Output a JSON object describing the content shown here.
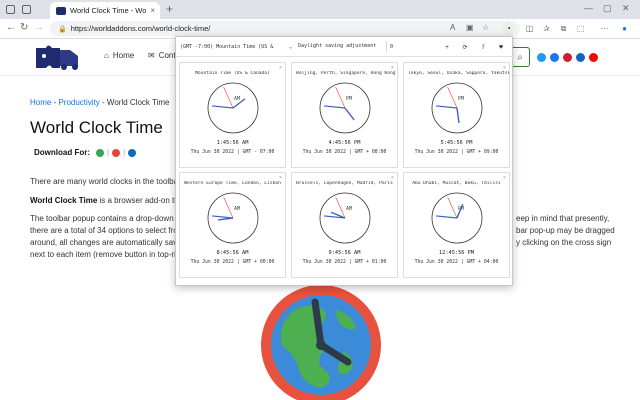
{
  "browser": {
    "tab_title": "World Clock Time - WorldAdd",
    "tab_close": "×",
    "new_tab": "+",
    "url": "https://worldaddons.com/world-clock-time/"
  },
  "site": {
    "nav": {
      "home": "Home",
      "contact": "Cont"
    },
    "breadcrumb": {
      "home": "Home",
      "sep": " - ",
      "category": "Productivity",
      "current": " - World Clock Time"
    },
    "title": "World Clock Time",
    "download_for": "Download For:",
    "para1": "There are many world clocks in the toolbar popu",
    "para2_bold": "World Clock Time",
    "para2_rest": " is a browser add-on that all",
    "para3_lines": [
      "The toolbar popup contains a drop-down menu",
      "there are a total of 34 options to select from. Yo",
      "around, all changes are automatically saved to",
      "next to each item (remove button in top-right c"
    ],
    "para3_right": [
      "eep in mind that presently,",
      "bar pop-up may be dragged",
      "y clicking on the cross sign"
    ]
  },
  "popup": {
    "timezone_selected": "(GMT -7:00) Mountain Time (US &",
    "dst_label": "Daylight saving adjustment",
    "dst_value": "0",
    "buttons": {
      "add": "+",
      "refresh": "⟳",
      "help": "?",
      "favorite": "♥"
    },
    "close_mark": "×",
    "clocks": [
      {
        "name": "Mountain Time (US & Canada)",
        "ampm": "AM",
        "time": "1:45:56 AM",
        "date": "Thu Jun 30 2022 | GMT - 07:00",
        "h": 1,
        "m": 45,
        "s": 56
      },
      {
        "name": "Beijing, Perth, Singapore, Hong Kong",
        "ampm": "PM",
        "time": "4:45:56 PM",
        "date": "Thu Jun 30 2022 | GMT + 08:00",
        "h": 4,
        "m": 45,
        "s": 56
      },
      {
        "name": "Tokyo, Seoul, Osaka, Sapporo, Yakutsk",
        "ampm": "PM",
        "time": "5:45:56 PM",
        "date": "Thu Jun 30 2022 | GMT + 09:00",
        "h": 5,
        "m": 45,
        "s": 56
      },
      {
        "name": "Western Europe Time, London, Lisbon",
        "ampm": "AM",
        "time": "8:45:56 AM",
        "date": "Thu Jun 30 2022 | GMT + 00:00",
        "h": 8,
        "m": 45,
        "s": 56
      },
      {
        "name": "Brussels, Copenhagen, Madrid, Paris",
        "ampm": "AM",
        "time": "9:45:56 AM",
        "date": "Thu Jun 30 2022 | GMT + 01:00",
        "h": 9,
        "m": 45,
        "s": 56
      },
      {
        "name": "Abu Dhabi, Muscat, Baku, Tbilisi",
        "ampm": "PM",
        "time": "12:45:56 PM",
        "date": "Thu Jun 30 2022 | GMT + 04:00",
        "h": 12,
        "m": 45,
        "s": 56
      }
    ]
  }
}
